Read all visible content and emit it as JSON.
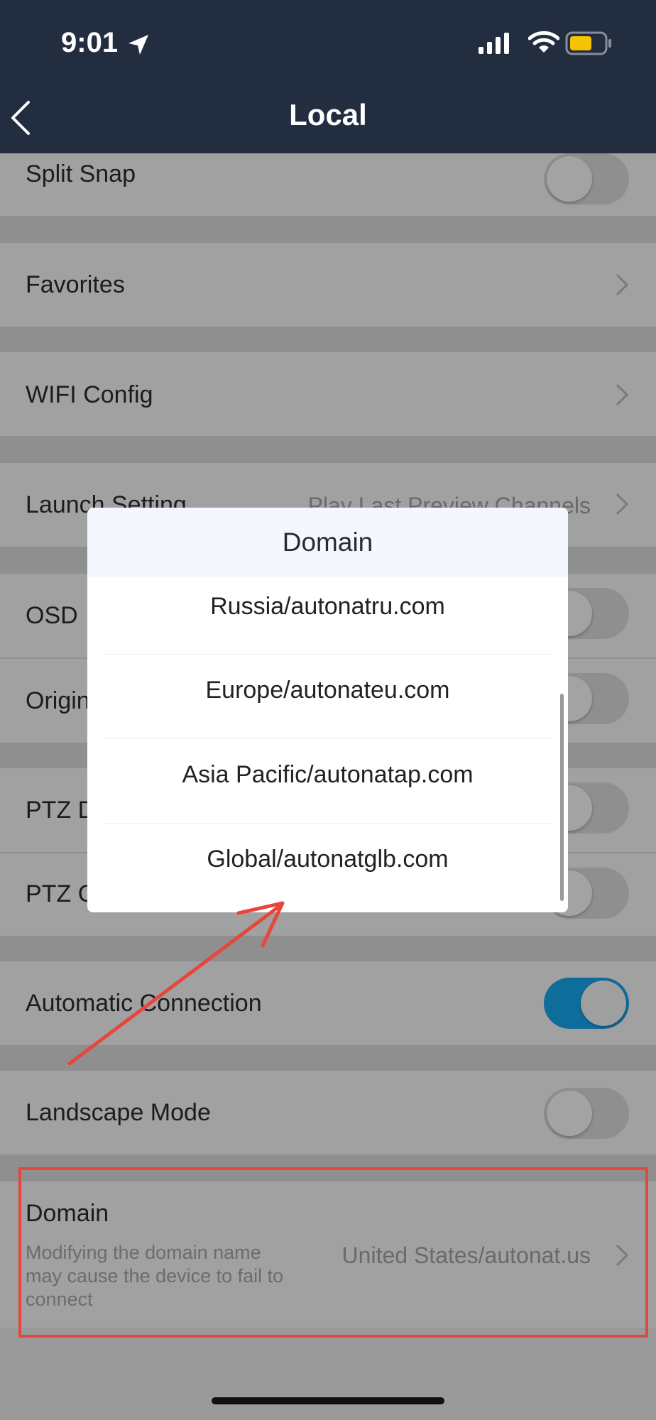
{
  "status_bar": {
    "time": "9:01"
  },
  "header": {
    "title": "Local"
  },
  "rows": {
    "split_snap": "Split Snap",
    "favorites": "Favorites",
    "wifi_config": "WIFI Config",
    "launch_setting": "Launch Setting",
    "launch_setting_value": "Play Last Preview Channels",
    "osd": "OSD",
    "original": "Origin",
    "ptz_d": "PTZ D",
    "ptz_c": "PTZ C",
    "automatic_connection": "Automatic Connection",
    "landscape_mode": "Landscape Mode",
    "domain": "Domain",
    "domain_desc": "Modifying the domain name may cause the device to fail to connect",
    "domain_value": "United States/autonat.us"
  },
  "toggles": {
    "split_snap": false,
    "osd": false,
    "original": false,
    "ptz_d": false,
    "ptz_c": false,
    "automatic_connection": true,
    "landscape_mode": false
  },
  "dialog": {
    "title": "Domain",
    "options": [
      "Russia/autonatru.com",
      "Europe/autonateu.com",
      "Asia Pacific/autonatap.com",
      "Global/autonatglb.com"
    ]
  },
  "colors": {
    "header_bg": "#222d40",
    "toggle_on": "#0f6d9c",
    "annotation_red": "#e8453c",
    "battery_fill": "#f5c400"
  }
}
